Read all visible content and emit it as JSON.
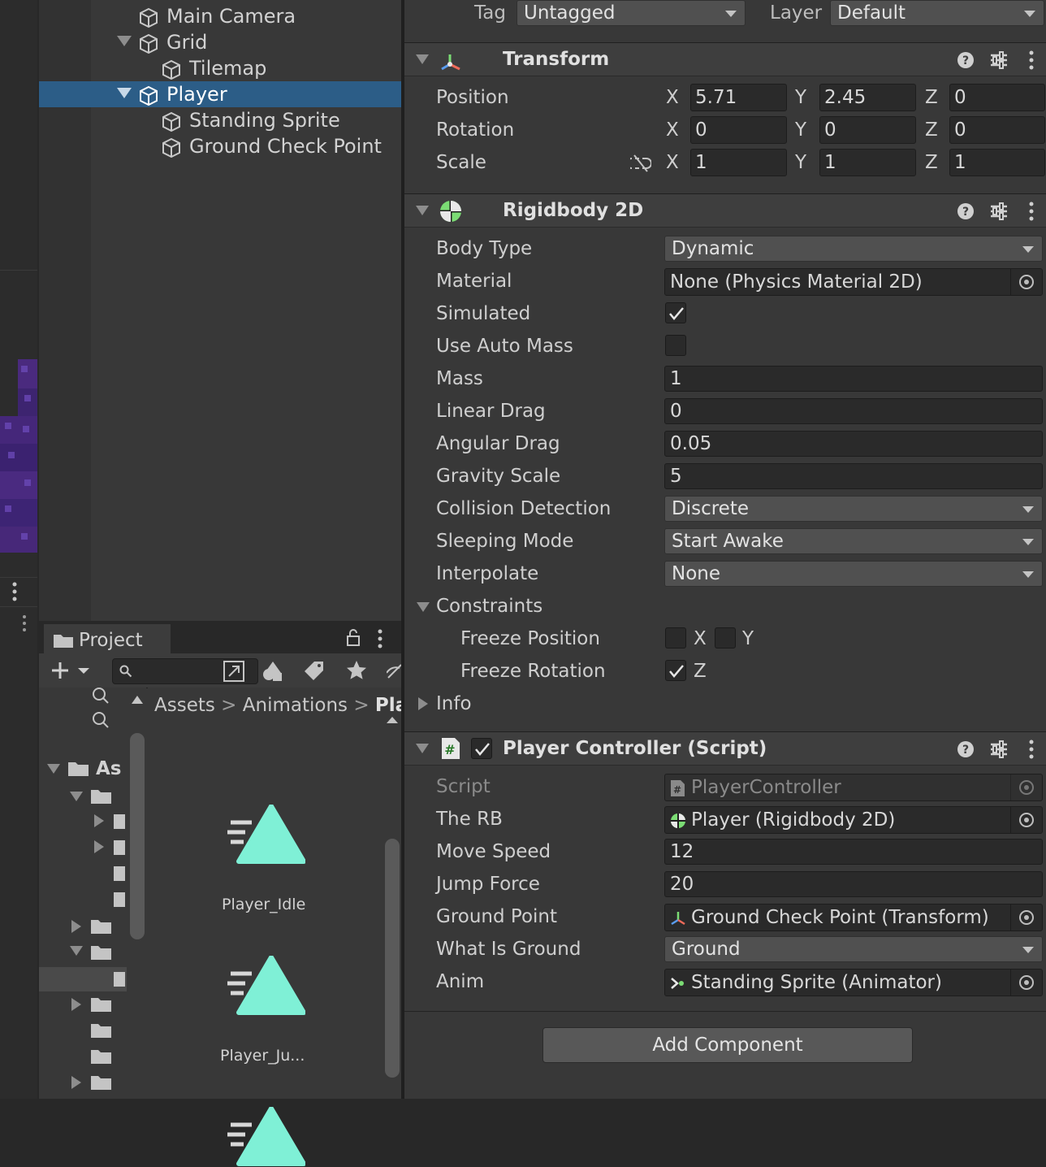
{
  "colors": {
    "selection": "#2c5d87",
    "bg": "#383838",
    "field": "#2a2a2a",
    "accent_green": "#7bdc74",
    "asset_icon": "#7ff0d6"
  },
  "hierarchy": {
    "items": [
      {
        "label": "Main Camera",
        "depth": 1,
        "expanded": null,
        "selected": false
      },
      {
        "label": "Grid",
        "depth": 1,
        "expanded": true,
        "selected": false
      },
      {
        "label": "Tilemap",
        "depth": 2,
        "expanded": null,
        "selected": false
      },
      {
        "label": "Player",
        "depth": 1,
        "expanded": true,
        "selected": true
      },
      {
        "label": "Standing Sprite",
        "depth": 2,
        "expanded": null,
        "selected": false
      },
      {
        "label": "Ground Check Point",
        "depth": 2,
        "expanded": null,
        "selected": false
      }
    ]
  },
  "project": {
    "tab_label": "Project",
    "tree_root_label": "As",
    "breadcrumb": [
      "Assets",
      "Animations",
      "Pla"
    ],
    "assets": [
      "Player_Idle",
      "Player_Ju..."
    ]
  },
  "inspector": {
    "tag_label": "Tag",
    "tag_value": "Untagged",
    "layer_label": "Layer",
    "layer_value": "Default",
    "transform": {
      "title": "Transform",
      "rows": [
        {
          "label": "Position",
          "x": "5.71",
          "y": "2.45",
          "z": "0"
        },
        {
          "label": "Rotation",
          "x": "0",
          "y": "0",
          "z": "0"
        },
        {
          "label": "Scale",
          "x": "1",
          "y": "1",
          "z": "1"
        }
      ]
    },
    "rigidbody": {
      "title": "Rigidbody 2D",
      "body_type_label": "Body Type",
      "body_type": "Dynamic",
      "material_label": "Material",
      "material": "None (Physics Material 2D)",
      "simulated_label": "Simulated",
      "simulated": true,
      "auto_mass_label": "Use Auto Mass",
      "auto_mass": false,
      "mass_label": "Mass",
      "mass": "1",
      "linear_drag_label": "Linear Drag",
      "linear_drag": "0",
      "angular_drag_label": "Angular Drag",
      "angular_drag": "0.05",
      "gravity_label": "Gravity Scale",
      "gravity": "5",
      "collision_label": "Collision Detection",
      "collision": "Discrete",
      "sleeping_label": "Sleeping Mode",
      "sleeping": "Start Awake",
      "interpolate_label": "Interpolate",
      "interpolate": "None",
      "constraints_label": "Constraints",
      "freeze_pos_label": "Freeze Position",
      "freeze_pos_x": "X",
      "freeze_pos_y": "Y",
      "freeze_rot_label": "Freeze Rotation",
      "freeze_rot_z": "Z",
      "info_label": "Info"
    },
    "player_controller": {
      "title": "Player Controller (Script)",
      "script_label": "Script",
      "script": "PlayerController",
      "rb_label": "The RB",
      "rb": "Player (Rigidbody 2D)",
      "move_label": "Move Speed",
      "move": "12",
      "jump_label": "Jump Force",
      "jump": "20",
      "ground_point_label": "Ground Point",
      "ground_point": "Ground Check Point (Transform)",
      "what_ground_label": "What Is Ground",
      "what_ground": "Ground",
      "anim_label": "Anim",
      "anim": "Standing Sprite (Animator)"
    },
    "add_component": "Add Component"
  }
}
